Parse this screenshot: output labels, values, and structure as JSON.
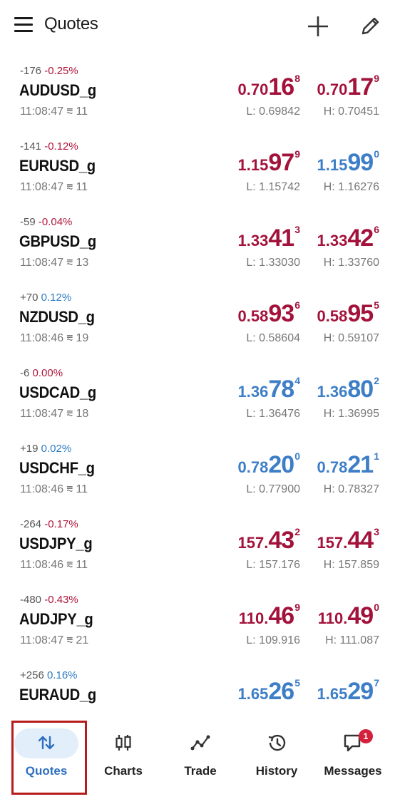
{
  "header": {
    "title": "Quotes",
    "menu_icon": "menu-icon",
    "add_icon": "plus-icon",
    "edit_icon": "pencil-icon"
  },
  "colors": {
    "down": "#a3123a",
    "up": "#3d7ec7",
    "active_tab": "#2f6fc0",
    "highlight_border": "#b71c1c"
  },
  "quotes": [
    {
      "change_points": "-176",
      "change_pct": "-0.25%",
      "pct_dir": "neg",
      "symbol": "AUDUSD_g",
      "time": "11:08:47",
      "spread": "11",
      "bid": {
        "p1": "0.70",
        "p2": "16",
        "p3": "8",
        "dir": "red"
      },
      "ask": {
        "p1": "0.70",
        "p2": "17",
        "p3": "9",
        "dir": "red"
      },
      "low": "L: 0.69842",
      "high": "H: 0.70451"
    },
    {
      "change_points": "-141",
      "change_pct": "-0.12%",
      "pct_dir": "neg",
      "symbol": "EURUSD_g",
      "time": "11:08:47",
      "spread": "11",
      "bid": {
        "p1": "1.15",
        "p2": "97",
        "p3": "9",
        "dir": "red"
      },
      "ask": {
        "p1": "1.15",
        "p2": "99",
        "p3": "0",
        "dir": "blue"
      },
      "low": "L: 1.15742",
      "high": "H: 1.16276"
    },
    {
      "change_points": "-59",
      "change_pct": "-0.04%",
      "pct_dir": "neg",
      "symbol": "GBPUSD_g",
      "time": "11:08:47",
      "spread": "13",
      "bid": {
        "p1": "1.33",
        "p2": "41",
        "p3": "3",
        "dir": "red"
      },
      "ask": {
        "p1": "1.33",
        "p2": "42",
        "p3": "6",
        "dir": "red"
      },
      "low": "L: 1.33030",
      "high": "H: 1.33760"
    },
    {
      "change_points": "+70",
      "change_pct": "0.12%",
      "pct_dir": "pos",
      "symbol": "NZDUSD_g",
      "time": "11:08:46",
      "spread": "19",
      "bid": {
        "p1": "0.58",
        "p2": "93",
        "p3": "6",
        "dir": "red"
      },
      "ask": {
        "p1": "0.58",
        "p2": "95",
        "p3": "5",
        "dir": "red"
      },
      "low": "L: 0.58604",
      "high": "H: 0.59107"
    },
    {
      "change_points": "-6",
      "change_pct": "0.00%",
      "pct_dir": "neg",
      "symbol": "USDCAD_g",
      "time": "11:08:47",
      "spread": "18",
      "bid": {
        "p1": "1.36",
        "p2": "78",
        "p3": "4",
        "dir": "blue"
      },
      "ask": {
        "p1": "1.36",
        "p2": "80",
        "p3": "2",
        "dir": "blue"
      },
      "low": "L: 1.36476",
      "high": "H: 1.36995"
    },
    {
      "change_points": "+19",
      "change_pct": "0.02%",
      "pct_dir": "pos",
      "symbol": "USDCHF_g",
      "time": "11:08:46",
      "spread": "11",
      "bid": {
        "p1": "0.78",
        "p2": "20",
        "p3": "0",
        "dir": "blue"
      },
      "ask": {
        "p1": "0.78",
        "p2": "21",
        "p3": "1",
        "dir": "blue"
      },
      "low": "L: 0.77900",
      "high": "H: 0.78327"
    },
    {
      "change_points": "-264",
      "change_pct": "-0.17%",
      "pct_dir": "neg",
      "symbol": "USDJPY_g",
      "time": "11:08:46",
      "spread": "11",
      "bid": {
        "p1": "157.",
        "p2": "43",
        "p3": "2",
        "dir": "red"
      },
      "ask": {
        "p1": "157.",
        "p2": "44",
        "p3": "3",
        "dir": "red"
      },
      "low": "L: 157.176",
      "high": "H: 157.859"
    },
    {
      "change_points": "-480",
      "change_pct": "-0.43%",
      "pct_dir": "neg",
      "symbol": "AUDJPY_g",
      "time": "11:08:47",
      "spread": "21",
      "bid": {
        "p1": "110.",
        "p2": "46",
        "p3": "9",
        "dir": "red"
      },
      "ask": {
        "p1": "110.",
        "p2": "49",
        "p3": "0",
        "dir": "red"
      },
      "low": "L: 109.916",
      "high": "H: 111.087"
    },
    {
      "change_points": "+256",
      "change_pct": "0.16%",
      "pct_dir": "pos",
      "symbol": "EURAUD_g",
      "time": "",
      "spread": "",
      "bid": {
        "p1": "1.65",
        "p2": "26",
        "p3": "5",
        "dir": "blue"
      },
      "ask": {
        "p1": "1.65",
        "p2": "29",
        "p3": "7",
        "dir": "blue"
      },
      "low": "",
      "high": ""
    }
  ],
  "tabs": [
    {
      "label": "Quotes",
      "icon": "sort-arrows-icon",
      "active": true
    },
    {
      "label": "Charts",
      "icon": "candlestick-icon",
      "active": false
    },
    {
      "label": "Trade",
      "icon": "trend-line-icon",
      "active": false
    },
    {
      "label": "History",
      "icon": "history-clock-icon",
      "active": false
    },
    {
      "label": "Messages",
      "icon": "chat-bubble-icon",
      "active": false,
      "badge": "1"
    }
  ]
}
